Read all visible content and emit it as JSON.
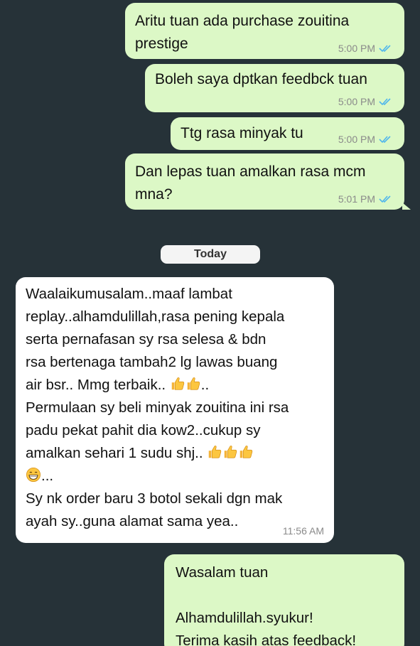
{
  "messages": [
    {
      "id": "m1",
      "direction": "outgoing",
      "text": "Aritu tuan ada purchase zouitina\nprestige",
      "time": "5:00 PM",
      "status": "read"
    },
    {
      "id": "m2",
      "direction": "outgoing",
      "text": "Boleh saya dptkan feedbck tuan",
      "time": "5:00 PM",
      "status": "read"
    },
    {
      "id": "m3",
      "direction": "outgoing",
      "text": "Ttg rasa minyak tu",
      "time": "5:00 PM",
      "status": "read"
    },
    {
      "id": "m4",
      "direction": "outgoing",
      "text": "Dan lepas tuan amalkan rasa mcm\nmna?",
      "time": "5:01 PM",
      "status": "read"
    }
  ],
  "day_separator": "Today",
  "incoming": {
    "lines": [
      "Waalaikumusalam..maaf lambat",
      "replay..alhamdulillah,rasa pening kepala",
      "serta pernafasan sy rsa selesa & bdn",
      "rsa bertenaga tambah2 lg lawas buang",
      "air bsr.. Mmg terbaik..",
      "Permulaan sy beli minyak zouitina ini rsa",
      "padu pekat pahit dia kow2..cukup sy",
      "amalkan sehari 1 sudu shj..",
      "...",
      "Sy nk order baru 3 botol sekali dgn mak",
      "ayah sy..guna alamat sama yea.."
    ],
    "trail_after_line5": "..",
    "time": "11:56 AM",
    "emoji": {
      "thumbs": "thumbs-up-icon",
      "grin": "grinning-face-icon"
    }
  },
  "reply": {
    "lines": [
      "Wasalam tuan",
      "",
      "Alhamdulillah.syukur!",
      "Terima kasih atas feedback!"
    ]
  },
  "colors": {
    "background": "#263238",
    "outgoing": "#dcf8c6",
    "incoming": "#ffffff",
    "read_ticks": "#4fb6ec"
  }
}
